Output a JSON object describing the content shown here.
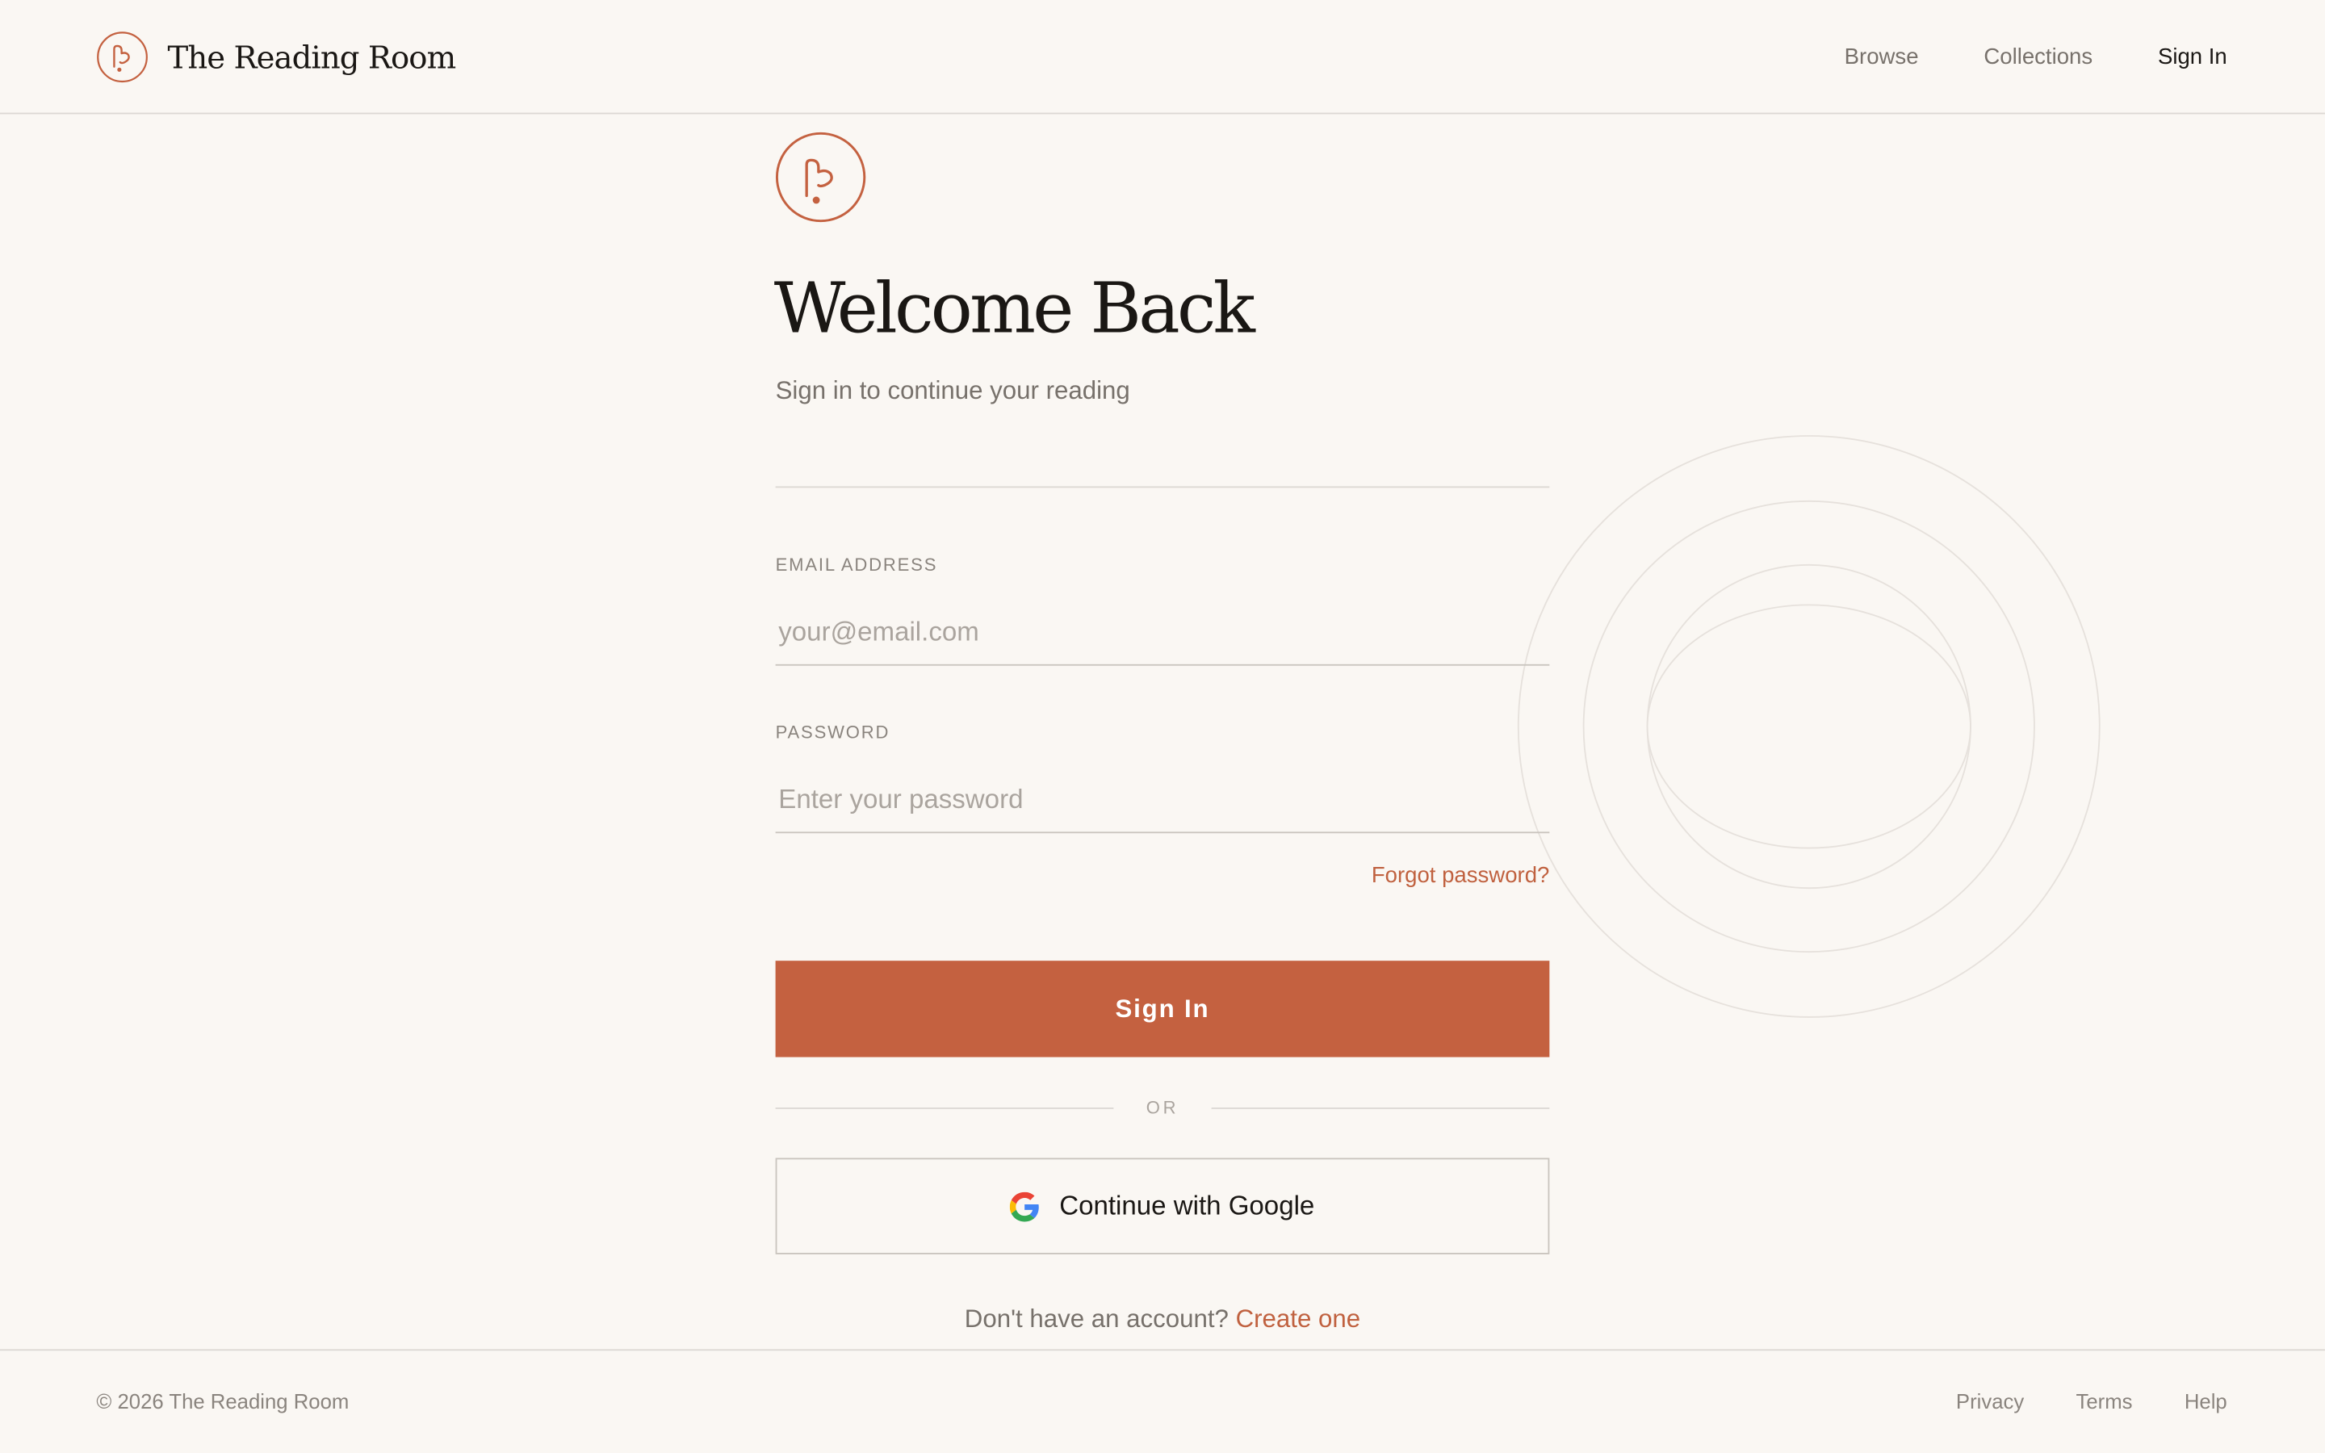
{
  "app": {
    "name": "The Reading Room"
  },
  "colors": {
    "accent": "#c46140",
    "background": "#faf7f3",
    "text": "#1a1714",
    "muted": "#77716b",
    "border": "#dcd8d3"
  },
  "nav": {
    "items": [
      {
        "label": "Browse",
        "active": false
      },
      {
        "label": "Collections",
        "active": false
      },
      {
        "label": "Sign In",
        "active": true
      }
    ]
  },
  "form": {
    "title": "Welcome Back",
    "subtitle": "Sign in to continue your reading",
    "email": {
      "label": "EMAIL ADDRESS",
      "placeholder": "your@email.com",
      "value": ""
    },
    "password": {
      "label": "PASSWORD",
      "placeholder": "Enter your password",
      "value": ""
    },
    "forgot_label": "Forgot password?",
    "submit_label": "Sign In",
    "divider_label": "OR",
    "google_label": "Continue with Google",
    "signup_prompt": "Don't have an account?",
    "signup_link": "Create one"
  },
  "icons": {
    "brand": "bookmark-logo-icon",
    "google": "google-g-icon"
  },
  "footer": {
    "copyright": "© 2026 The Reading Room",
    "links": [
      "Privacy",
      "Terms",
      "Help"
    ]
  }
}
